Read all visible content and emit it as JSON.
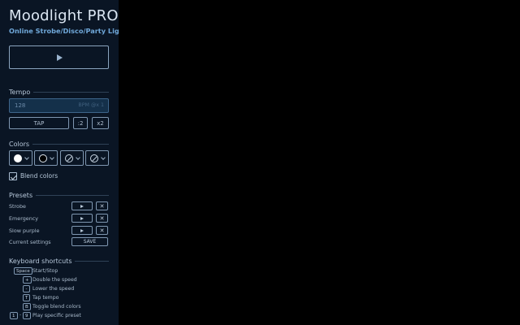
{
  "app": {
    "title": "Moodlight PRO",
    "subtitle": "Online Strobe/Disco/Party Light"
  },
  "main_play": {
    "icon": "play-icon"
  },
  "tempo": {
    "heading": "Tempo",
    "value": "128",
    "unit": "BPM @x 1",
    "tap_label": "TAP",
    "half_label": ":2",
    "double_label": "x2"
  },
  "colors": {
    "heading": "Colors",
    "swatches": [
      {
        "kind": "white",
        "icon": "filled-circle-icon"
      },
      {
        "kind": "black",
        "icon": "hollow-circle-icon"
      },
      {
        "kind": "none",
        "icon": "no-color-icon"
      },
      {
        "kind": "none",
        "icon": "no-color-icon"
      }
    ],
    "blend_label": "Blend colors",
    "blend_checked": true
  },
  "presets": {
    "heading": "Presets",
    "items": [
      {
        "name": "Strobe"
      },
      {
        "name": "Emergency"
      },
      {
        "name": "Slow purple"
      }
    ],
    "current_label": "Current settings",
    "save_label": "SAVE"
  },
  "shortcuts": {
    "heading": "Keyboard shortcuts",
    "items": [
      {
        "key": "Space",
        "desc": "Start/Stop"
      },
      {
        "key": "+",
        "desc": "Double the speed"
      },
      {
        "key": "-",
        "desc": "Lower the speed"
      },
      {
        "key": "T",
        "desc": "Tap tempo"
      },
      {
        "key": "B",
        "desc": "Toggle blend colors"
      }
    ],
    "range": {
      "from": "1",
      "to": "9",
      "separator": "-",
      "desc": "Play specific preset"
    }
  },
  "theme": {
    "sidebar_bg": "#0a1524",
    "stage_bg": "#000000",
    "accent": "#6fa7d8"
  }
}
